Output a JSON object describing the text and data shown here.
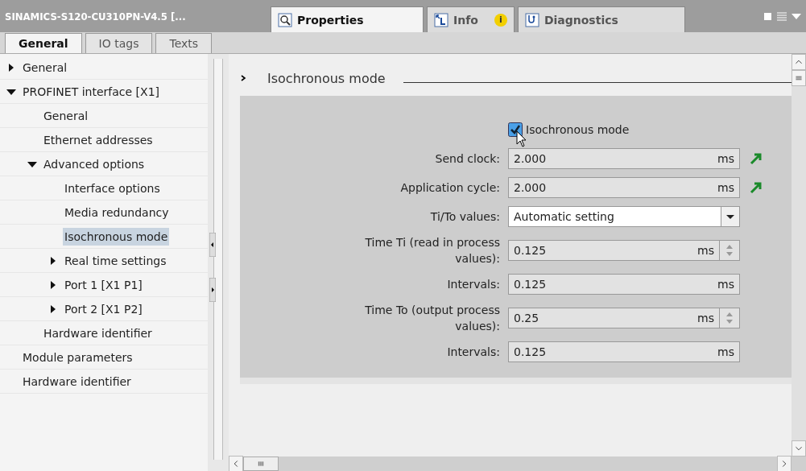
{
  "title_bar": {
    "title": "SINAMICS-S120-CU310PN-V4.5  [...",
    "tabs": [
      {
        "kind": "properties",
        "label": "Properties",
        "selected": true
      },
      {
        "kind": "info",
        "label": "Info",
        "selected": false,
        "badge": "i"
      },
      {
        "kind": "diagnostics",
        "label": "Diagnostics",
        "selected": false
      }
    ]
  },
  "sub_tabs": [
    {
      "label": "General",
      "selected": true
    },
    {
      "label": "IO tags",
      "selected": false
    },
    {
      "label": "Texts",
      "selected": false
    }
  ],
  "tree": [
    {
      "label": "General",
      "expanded": false,
      "selected": false
    },
    {
      "label": "PROFINET interface [X1]",
      "expanded": true,
      "selected": false,
      "children": [
        {
          "label": "General",
          "selected": false
        },
        {
          "label": "Ethernet addresses",
          "selected": false
        },
        {
          "label": "Advanced options",
          "expanded": true,
          "selected": false,
          "children": [
            {
              "label": "Interface options",
              "selected": false
            },
            {
              "label": "Media redundancy",
              "selected": false
            },
            {
              "label": "Isochronous mode",
              "selected": true
            },
            {
              "label": "Real time settings",
              "expanded": false,
              "selected": false
            },
            {
              "label": "Port 1 [X1 P1]",
              "expanded": false,
              "selected": false
            },
            {
              "label": "Port 2 [X1 P2]",
              "expanded": false,
              "selected": false
            }
          ]
        },
        {
          "label": "Hardware identifier",
          "selected": false
        }
      ]
    },
    {
      "label": "Module parameters",
      "selected": false
    },
    {
      "label": "Hardware identifier",
      "selected": false
    }
  ],
  "section": {
    "title": "Isochronous mode",
    "expanded": true,
    "rows": [
      {
        "kind": "checkbox",
        "label": "Isochronous mode",
        "checked": true
      },
      {
        "kind": "field",
        "label": "Send clock:",
        "value": "2.000",
        "unit": "ms",
        "link": true
      },
      {
        "kind": "field",
        "label": "Application cycle:",
        "value": "2.000",
        "unit": "ms",
        "link": true
      },
      {
        "kind": "dropdown",
        "label": "Ti/To values:",
        "value": "Automatic setting"
      },
      {
        "kind": "spinner",
        "label": "Time Ti (read in process values):",
        "value": "0.125",
        "unit": "ms"
      },
      {
        "kind": "field",
        "label": "Intervals:",
        "value": "0.125",
        "unit": "ms",
        "link": false
      },
      {
        "kind": "spinner",
        "label": "Time To (output process values):",
        "value": "0.25",
        "unit": "ms"
      },
      {
        "kind": "field",
        "label": "Intervals:",
        "value": "0.125",
        "unit": "ms",
        "link": false
      }
    ]
  }
}
